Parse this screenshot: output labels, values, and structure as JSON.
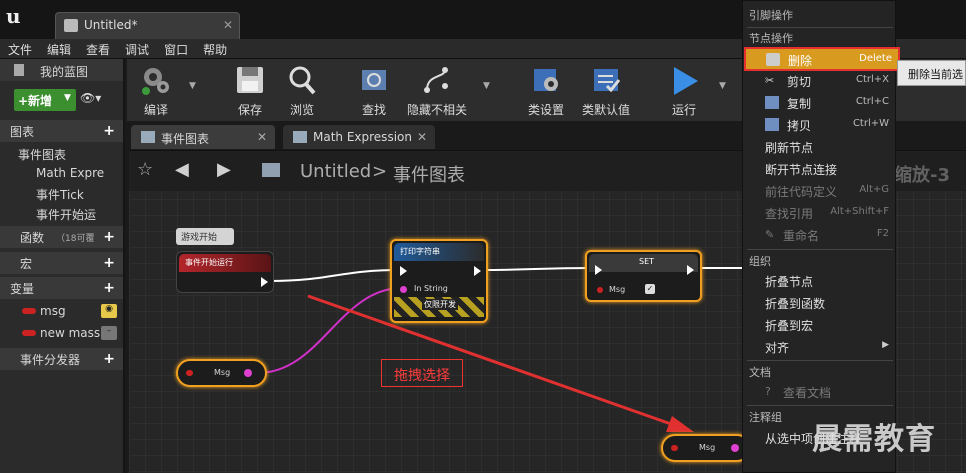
{
  "window": {
    "tab_label": "Untitled*"
  },
  "menu": [
    "文件",
    "编辑",
    "查看",
    "调试",
    "窗口",
    "帮助"
  ],
  "left_panel": {
    "header": "我的蓝图",
    "new_button": "+新增",
    "sections": {
      "graphs": "图表",
      "event_graph": "事件图表",
      "math_expr": "Math Expre",
      "event_tick": "事件Tick",
      "event_begin": "事件开始运",
      "functions": "函数",
      "functions_note": "（18可覆",
      "macros": "宏",
      "variables": "变量",
      "var_msg": "msg",
      "var_newmsg": "new mass",
      "dispatchers": "事件分发器"
    }
  },
  "toolbar": [
    {
      "label": "编译",
      "icon": "compile-icon"
    },
    {
      "label": "保存",
      "icon": "save-icon"
    },
    {
      "label": "浏览",
      "icon": "browse-icon"
    },
    {
      "label": "查找",
      "icon": "find-icon"
    },
    {
      "label": "隐藏不相关",
      "icon": "hide-unrelated-icon"
    },
    {
      "label": "类设置",
      "icon": "class-settings-icon"
    },
    {
      "label": "类默认值",
      "icon": "class-defaults-icon"
    },
    {
      "label": "运行",
      "icon": "play-icon"
    }
  ],
  "graph_tabs": [
    "事件图表",
    "Math Expression"
  ],
  "breadcrumb": {
    "root": "Untitled",
    "separator": ">",
    "current": "事件图表",
    "zoom": "缩放-3"
  },
  "nodes": {
    "comment": "游戏开始",
    "begin_play": "事件开始运行",
    "print_string": "打印字符串",
    "print_in": "In String",
    "print_dev": "仅限开发",
    "set": "SET",
    "set_msg": "Msg",
    "get_msg_1": "Msg",
    "get_msg_2": "Msg"
  },
  "context_menu": {
    "section_pin": "引脚操作",
    "section_node": "节点操作",
    "items_node": [
      {
        "label": "删除",
        "shortcut": "Delete",
        "enabled": true
      },
      {
        "label": "剪切",
        "shortcut": "Ctrl+X",
        "enabled": true
      },
      {
        "label": "复制",
        "shortcut": "Ctrl+C",
        "enabled": true
      },
      {
        "label": "拷贝",
        "shortcut": "Ctrl+W",
        "enabled": true
      },
      {
        "label": "刷新节点",
        "shortcut": "",
        "enabled": true
      },
      {
        "label": "断开节点连接",
        "shortcut": "",
        "enabled": true
      },
      {
        "label": "前往代码定义",
        "shortcut": "Alt+G",
        "enabled": false
      },
      {
        "label": "查找引用",
        "shortcut": "Alt+Shift+F",
        "enabled": false
      },
      {
        "label": "重命名",
        "shortcut": "F2",
        "enabled": false
      }
    ],
    "section_org": "组织",
    "items_org": [
      "折叠节点",
      "折叠到函数",
      "折叠到宏",
      "对齐"
    ],
    "section_doc": "文档",
    "item_doc": "查看文档",
    "section_comment": "注释组",
    "item_comment": "从选中项创建注释"
  },
  "tooltip": "删除当前选",
  "annotation": "拖拽选择",
  "watermark": "晨需教育",
  "colors": {
    "accent_orange": "#f0a020",
    "event_red": "#b3262b",
    "pin_magenta": "#e040d0",
    "highlight_border": "#e53030",
    "new_green": "#3b8f2f"
  }
}
